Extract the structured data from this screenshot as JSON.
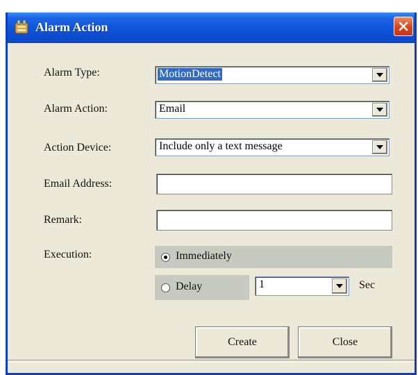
{
  "window": {
    "title": "Alarm Action",
    "close_icon": "close-icon",
    "app_icon": "alarm-app-icon"
  },
  "form": {
    "alarm_type": {
      "label": "Alarm Type:",
      "value": "MotionDetect"
    },
    "alarm_action": {
      "label": "Alarm Action:",
      "value": "Email"
    },
    "action_device": {
      "label": "Action Device:",
      "value": "Include only a text message"
    },
    "email_address": {
      "label": "Email Address:",
      "value": ""
    },
    "remark": {
      "label": "Remark:",
      "value": ""
    },
    "execution": {
      "label": "Execution:",
      "immediately_label": "Immediately",
      "delay_label": "Delay",
      "selected": "Immediately",
      "delay_value": "1",
      "unit_label": "Sec"
    }
  },
  "buttons": {
    "create": "Create",
    "close": "Close"
  },
  "colors": {
    "titlebar": "#0c52d8",
    "window_bg": "#ece9d8",
    "selection": "#316ac5",
    "close_button": "#d8431e"
  }
}
